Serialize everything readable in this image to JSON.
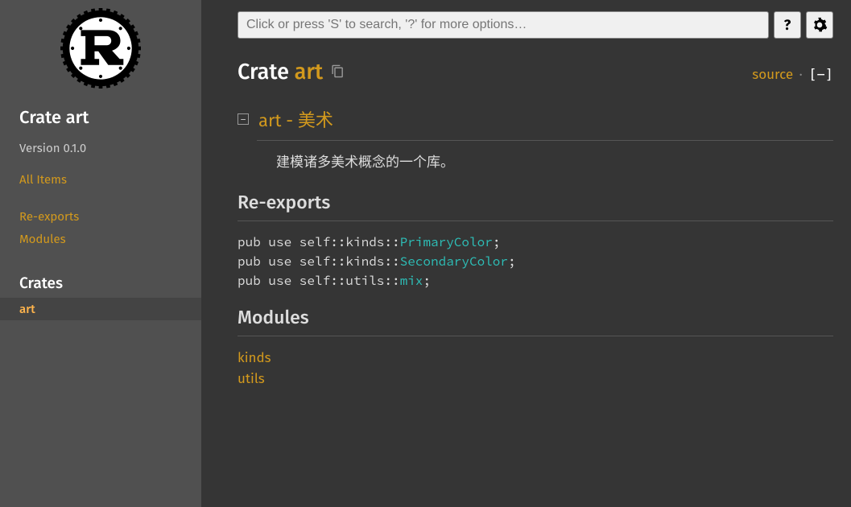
{
  "sidebar": {
    "title": "Crate art",
    "version": "Version 0.1.0",
    "all_items": "All Items",
    "links": [
      "Re-exports",
      "Modules"
    ],
    "crates_heading": "Crates",
    "crates": [
      "art"
    ]
  },
  "search": {
    "placeholder": "Click or press 'S' to search, '?' for more options…"
  },
  "topbar": {
    "help_label": "?",
    "settings_label": "⚙"
  },
  "title": {
    "prefix": "Crate ",
    "name": "art",
    "source": "source",
    "collapse": "[−]"
  },
  "detail": {
    "collapse_symbol": "−",
    "heading_name": "art",
    "heading_rest": " - 美术",
    "description": "建模诸多美术概念的一个库。"
  },
  "sections": {
    "reexports": {
      "heading": "Re-exports",
      "items": [
        {
          "prefix": "pub use self::kinds::",
          "link": "PrimaryColor",
          "suffix": ";"
        },
        {
          "prefix": "pub use self::kinds::",
          "link": "SecondaryColor",
          "suffix": ";"
        },
        {
          "prefix": "pub use self::utils::",
          "link": "mix",
          "suffix": ";"
        }
      ]
    },
    "modules": {
      "heading": "Modules",
      "items": [
        "kinds",
        "utils"
      ]
    }
  }
}
